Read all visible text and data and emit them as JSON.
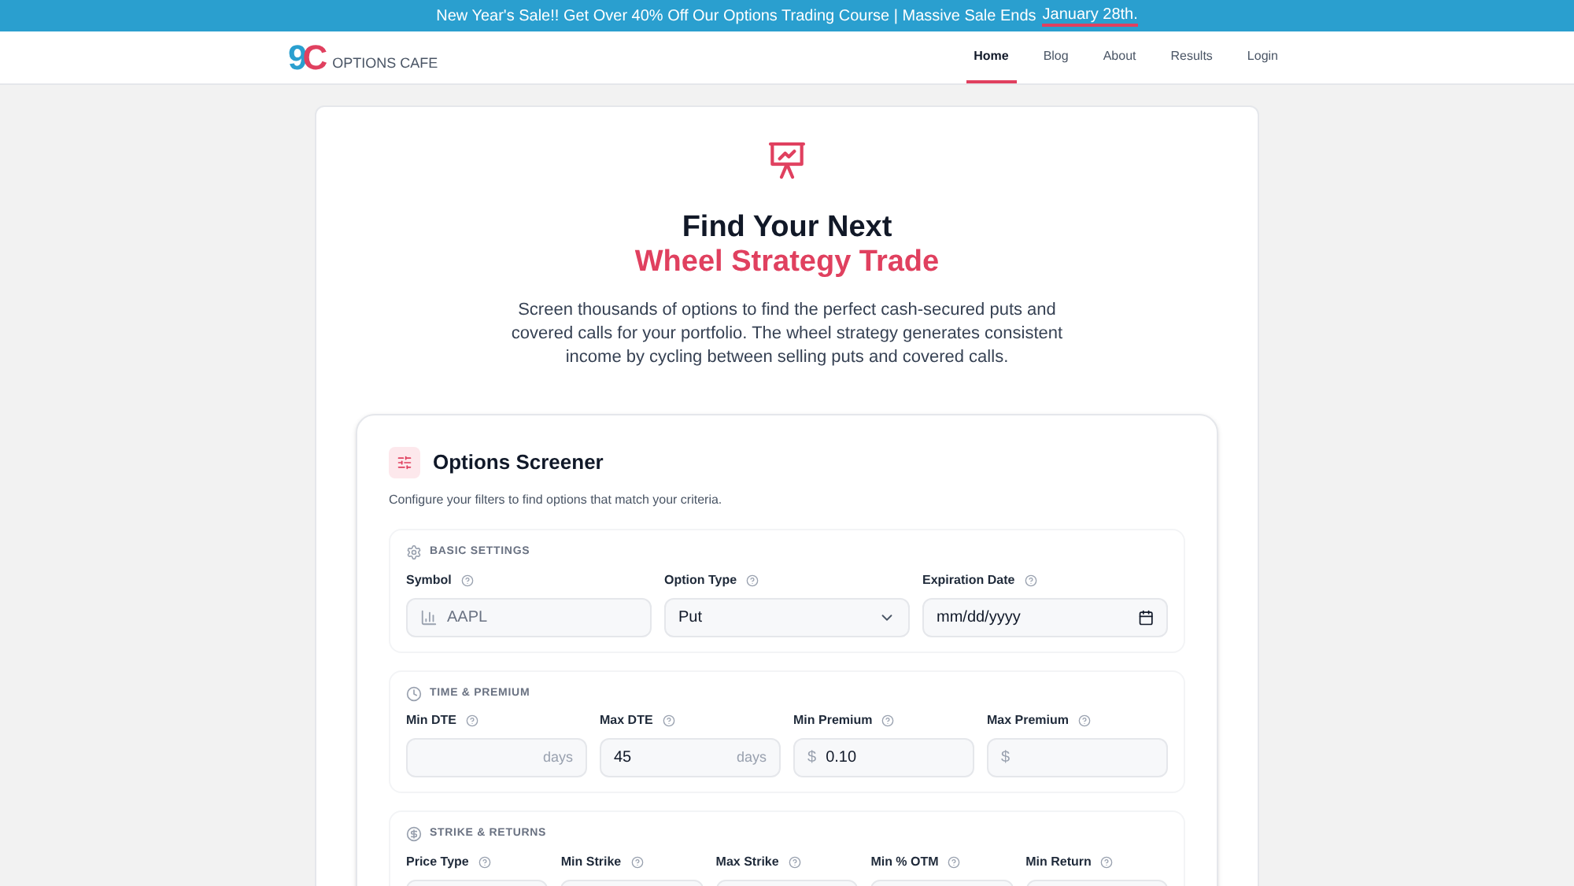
{
  "banner": {
    "text": "New Year's Sale!! Get Over 40% Off Our Options Trading Course | Massive Sale Ends",
    "link": "January 28th."
  },
  "brand": {
    "logo": "9C",
    "name": "OPTIONS CAFE"
  },
  "nav": [
    {
      "label": "Home",
      "selected": true
    },
    {
      "label": "Blog",
      "selected": false
    },
    {
      "label": "About",
      "selected": false
    },
    {
      "label": "Results",
      "selected": false
    },
    {
      "label": "Login",
      "selected": false
    }
  ],
  "hero": {
    "title": "Find Your Next",
    "title_accent": "Wheel Strategy Trade",
    "description": "Screen thousands of options to find the perfect cash-secured puts and covered calls for your portfolio. The wheel strategy generates consistent income by cycling between selling puts and covered calls."
  },
  "screener": {
    "title": "Options Screener",
    "subtitle": "Configure your filters to find options that match your criteria.",
    "sections": [
      {
        "title": "BASIC SETTINGS",
        "fields": [
          {
            "label": "Symbol",
            "kind": "text",
            "placeholder": "AAPL"
          },
          {
            "label": "Option Type",
            "kind": "select",
            "value": "Put"
          },
          {
            "label": "Expiration Date",
            "kind": "date",
            "placeholder": "mm/dd/yyyy"
          }
        ]
      },
      {
        "title": "TIME & PREMIUM",
        "fields": [
          {
            "label": "Min DTE",
            "kind": "text",
            "suffix": "days"
          },
          {
            "label": "Max DTE",
            "kind": "text",
            "value": "45",
            "suffix": "days"
          },
          {
            "label": "Min Premium",
            "kind": "text",
            "prefix": "$",
            "value": "0.10"
          },
          {
            "label": "Max Premium",
            "kind": "text",
            "prefix": "$"
          }
        ]
      },
      {
        "title": "STRIKE & RETURNS",
        "fields": [
          {
            "label": "Price Type",
            "kind": "text"
          },
          {
            "label": "Min Strike",
            "kind": "text"
          },
          {
            "label": "Max Strike",
            "kind": "text"
          },
          {
            "label": "Min % OTM",
            "kind": "text"
          },
          {
            "label": "Min Return",
            "kind": "text"
          }
        ]
      }
    ]
  }
}
